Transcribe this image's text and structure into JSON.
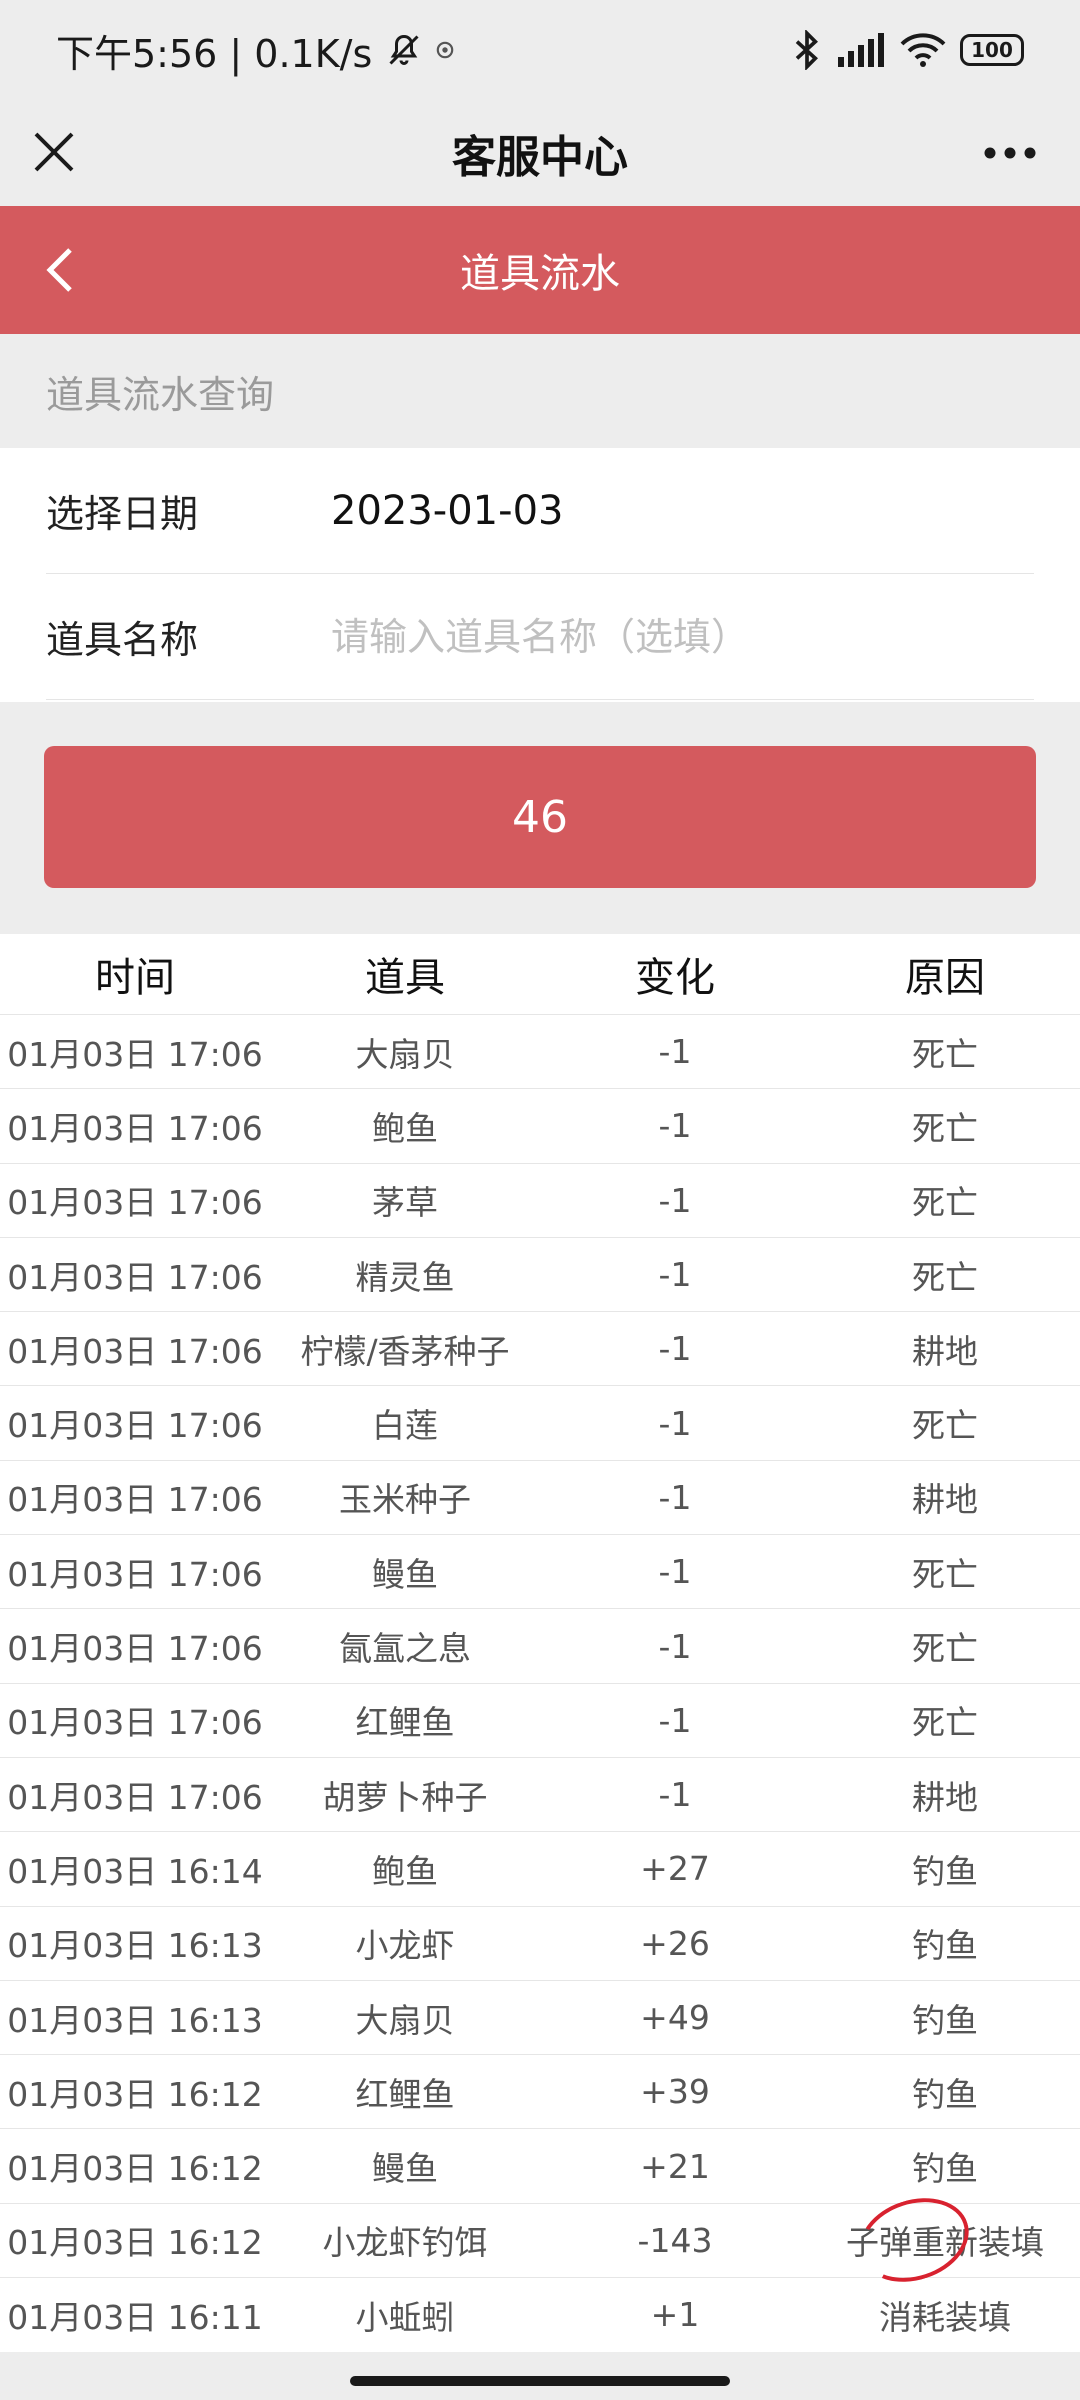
{
  "status_bar": {
    "time_speed": "下午5:56 | 0.1K/s",
    "battery": "100"
  },
  "nav": {
    "title": "客服中心"
  },
  "header": {
    "title": "道具流水"
  },
  "section": {
    "label": "道具流水查询"
  },
  "form": {
    "date_label": "选择日期",
    "date_value": "2023-01-03",
    "item_label": "道具名称",
    "item_placeholder": "请输入道具名称（选填）"
  },
  "button": {
    "label": "46"
  },
  "table": {
    "headers": [
      "时间",
      "道具",
      "变化",
      "原因"
    ],
    "rows": [
      [
        "01月03日 17:06",
        "大扇贝",
        "-1",
        "死亡"
      ],
      [
        "01月03日 17:06",
        "鲍鱼",
        "-1",
        "死亡"
      ],
      [
        "01月03日 17:06",
        "茅草",
        "-1",
        "死亡"
      ],
      [
        "01月03日 17:06",
        "精灵鱼",
        "-1",
        "死亡"
      ],
      [
        "01月03日 17:06",
        "柠檬/香茅种子",
        "-1",
        "耕地"
      ],
      [
        "01月03日 17:06",
        "白莲",
        "-1",
        "死亡"
      ],
      [
        "01月03日 17:06",
        "玉米种子",
        "-1",
        "耕地"
      ],
      [
        "01月03日 17:06",
        "鳗鱼",
        "-1",
        "死亡"
      ],
      [
        "01月03日 17:06",
        "氤氲之息",
        "-1",
        "死亡"
      ],
      [
        "01月03日 17:06",
        "红鲤鱼",
        "-1",
        "死亡"
      ],
      [
        "01月03日 17:06",
        "胡萝卜种子",
        "-1",
        "耕地"
      ],
      [
        "01月03日 16:14",
        "鲍鱼",
        "+27",
        "钓鱼"
      ],
      [
        "01月03日 16:13",
        "小龙虾",
        "+26",
        "钓鱼"
      ],
      [
        "01月03日 16:13",
        "大扇贝",
        "+49",
        "钓鱼"
      ],
      [
        "01月03日 16:12",
        "红鲤鱼",
        "+39",
        "钓鱼"
      ],
      [
        "01月03日 16:12",
        "鳗鱼",
        "+21",
        "钓鱼"
      ],
      [
        "01月03日 16:12",
        "小龙虾钓饵",
        "-143",
        "子弹重新装填"
      ],
      [
        "01月03日 16:11",
        "小蚯蚓",
        "+1",
        "消耗装填"
      ]
    ]
  }
}
